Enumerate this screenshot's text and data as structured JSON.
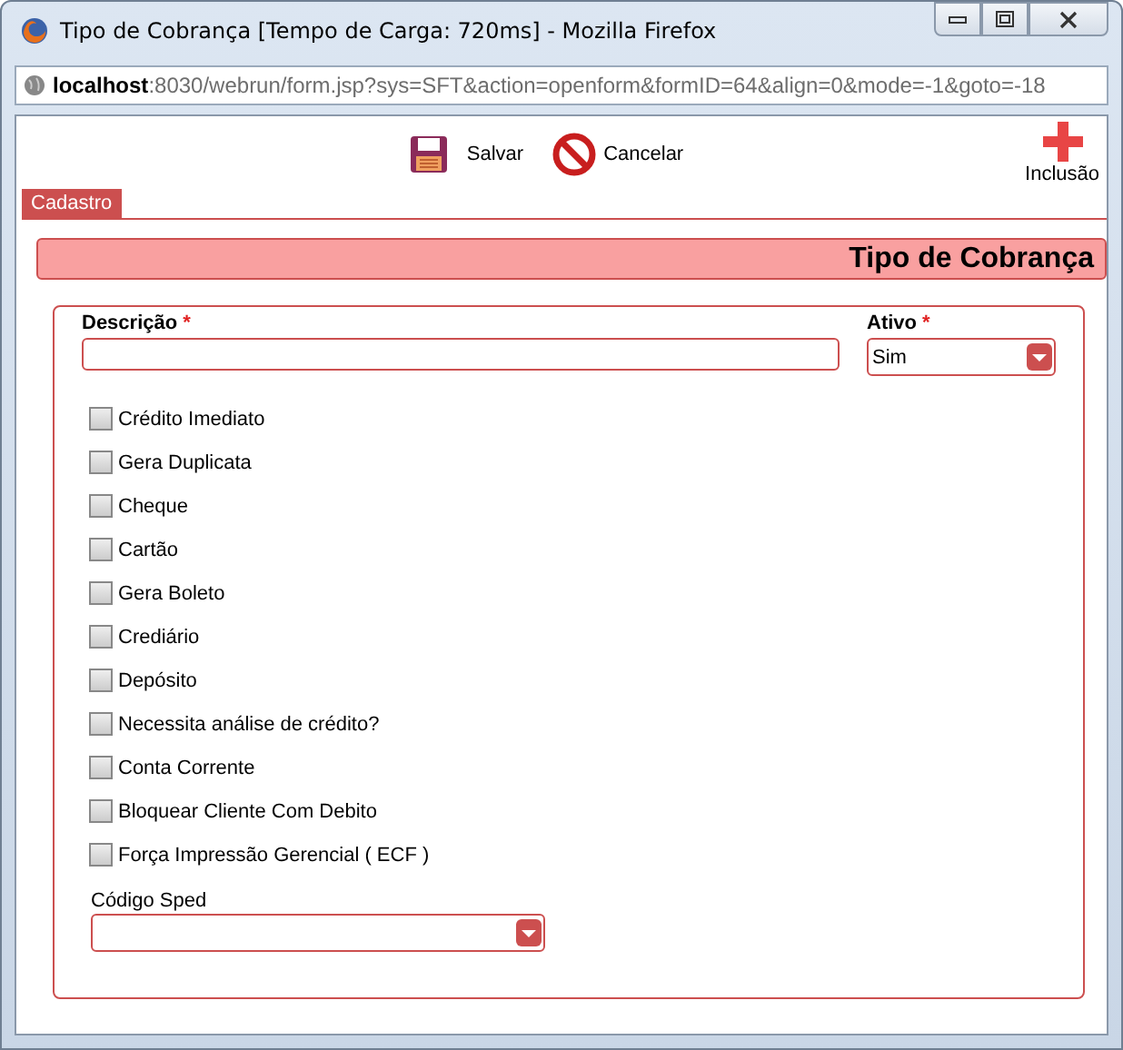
{
  "window": {
    "title": "Tipo de Cobrança [Tempo de Carga: 720ms] - Mozilla Firefox"
  },
  "address_bar": {
    "host": "localhost",
    "rest": ":8030/webrun/form.jsp?sys=SFT&action=openform&formID=64&align=0&mode=-1&goto=-18"
  },
  "toolbar": [
    {
      "kind": "save",
      "label": "Salvar"
    },
    {
      "kind": "cancel",
      "label": "Cancelar"
    }
  ],
  "add_button": {
    "label": "Inclusão"
  },
  "tabs": [
    {
      "label": "Cadastro",
      "selected": true
    }
  ],
  "form_title": "Tipo de Cobrança",
  "fields": {
    "descricao": {
      "label": "Descrição",
      "required_mark": "*"
    },
    "ativo": {
      "label": "Ativo",
      "required_mark": "*",
      "value": "Sim"
    }
  },
  "checkboxes": [
    {
      "label": "Crédito Imediato",
      "checked": false
    },
    {
      "label": "Gera Duplicata",
      "checked": false
    },
    {
      "label": "Cheque",
      "checked": false
    },
    {
      "label": "Cartão",
      "checked": false
    },
    {
      "label": "Gera Boleto",
      "checked": false
    },
    {
      "label": "Crediário",
      "checked": false
    },
    {
      "label": "Depósito",
      "checked": false
    },
    {
      "label": "Necessita análise de crédito?",
      "checked": false
    },
    {
      "label": "Conta Corrente",
      "checked": false
    },
    {
      "label": "Bloquear Cliente Com Debito",
      "checked": false
    },
    {
      "label": "Força Impressão Gerencial ( ECF )",
      "checked": false
    }
  ],
  "codigo_sped": {
    "label": "Código Sped"
  }
}
